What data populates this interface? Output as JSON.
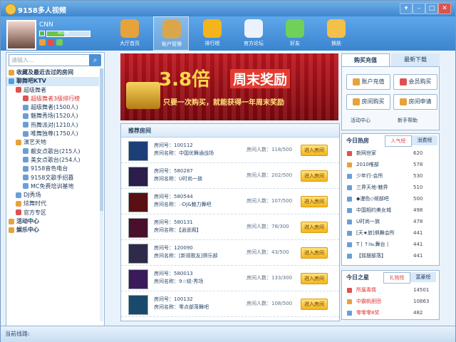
{
  "app": {
    "title": "9158多人视频"
  },
  "window_controls": {
    "menu": "▾",
    "minimize": "–",
    "maximize": "□",
    "close": "✕"
  },
  "user": {
    "name": "CNN",
    "level_pct": "40%"
  },
  "nav": [
    {
      "label": "大厅首页",
      "icon": "house-icon",
      "color": "#e6a23c"
    },
    {
      "label": "账户管理",
      "icon": "wallet-icon",
      "color": "#d9a74a",
      "active": true
    },
    {
      "label": "排行榜",
      "icon": "trophy-icon",
      "color": "#f3b51b"
    },
    {
      "label": "官方论坛",
      "icon": "chat-bubble-icon",
      "color": "#eaf2fb"
    },
    {
      "label": "好友",
      "icon": "users-icon",
      "color": "#6fd05a"
    },
    {
      "label": "换肤",
      "icon": "refresh-icon",
      "color": "#f5c04a"
    }
  ],
  "sidebar": {
    "search_placeholder": "请输入...",
    "tree": [
      {
        "label": "收藏及最近去过的房间",
        "level": 0,
        "color": "#e6a23c"
      },
      {
        "label": "聊舞吧KTV",
        "level": 0,
        "color": "#4aa3e0",
        "selected": true
      },
      {
        "label": "超级舞者",
        "level": 1,
        "color": "#e05050"
      },
      {
        "label": "超级舞者3级排行榜",
        "level": 2,
        "color": "#e05050",
        "red": true
      },
      {
        "label": "超级舞者(1500人)",
        "level": 2,
        "color": "#6b9ed6"
      },
      {
        "label": "魅舞秀场(1520人)",
        "level": 2,
        "color": "#6b9ed6"
      },
      {
        "label": "热舞派对(1210人)",
        "level": 2,
        "color": "#6b9ed6"
      },
      {
        "label": "唯舞独尊(1750人)",
        "level": 2,
        "color": "#6b9ed6"
      },
      {
        "label": "演艺天地",
        "level": 1,
        "color": "#e6a23c"
      },
      {
        "label": "靓女点歌台(215人)",
        "level": 2,
        "color": "#6b9ed6"
      },
      {
        "label": "美女点歌台(254人)",
        "level": 2,
        "color": "#6b9ed6"
      },
      {
        "label": "9158音色电台",
        "level": 2,
        "color": "#6b9ed6"
      },
      {
        "label": "9158文歌手招募",
        "level": 2,
        "color": "#6b9ed6"
      },
      {
        "label": "MC免费培训基地",
        "level": 2,
        "color": "#6b9ed6"
      },
      {
        "label": "DJ秀场",
        "level": 1,
        "color": "#6b9ed6"
      },
      {
        "label": "炫舞时代",
        "level": 1,
        "color": "#e6a23c"
      },
      {
        "label": "官方专区",
        "level": 1,
        "color": "#e05050"
      },
      {
        "label": "活动中心",
        "level": 0,
        "color": "#e6a23c"
      },
      {
        "label": "娱乐中心",
        "level": 0,
        "color": "#e6a23c"
      }
    ]
  },
  "banner": {
    "big": "3.8倍",
    "big2": "周末奖励",
    "sub": "只要一次购买，就能获得一年周末奖励"
  },
  "rooms": {
    "header": "推荐房间",
    "enter_label": "进入房间",
    "items": [
      {
        "id": "房间号：100112",
        "name": "房间名称：中国优舞通战场",
        "count": "房间人数：118/500",
        "color": "#1c3f78"
      },
      {
        "id": "房间号：580287",
        "name": "房间名称：U时尚一族",
        "count": "房间人数：202/500",
        "color": "#2b1e4a"
      },
      {
        "id": "房间号：580544",
        "name": "房间名称：.-DJ&魅力舞吧",
        "count": "房间人数：107/500",
        "color": "#5a0f12"
      },
      {
        "id": "房间号：580131",
        "name": "房间名称：【逍遥阁】",
        "count": "房间人数：78/300",
        "color": "#4a0f2b"
      },
      {
        "id": "房间号：120090",
        "name": "房间名称：[新视歌友]俱乐部",
        "count": "房间人数：43/500",
        "color": "#2f2a4a"
      },
      {
        "id": "房间号：580013",
        "name": "房间名称：9☆縂-秀场",
        "count": "房间人数：133/300",
        "color": "#3a1a5a"
      },
      {
        "id": "房间号：100132",
        "name": "房间名称：零点部落舞吧",
        "count": "房间人数：108/500",
        "color": "#1a4a6b"
      }
    ]
  },
  "right": {
    "tabs": [
      "购买充值",
      "最新下载"
    ],
    "buttons": [
      "账户充值",
      "会员购买",
      "房间购买",
      "房间申请"
    ],
    "links": [
      "活动中心",
      "新手帮助"
    ],
    "hot_title": "今日热房",
    "hot_tabs": [
      "人气榜",
      "消费榜"
    ],
    "hot": [
      {
        "name": "新网世家",
        "value": "620",
        "color": "#e05050"
      },
      {
        "name": "2010唯部",
        "value": "578",
        "color": "#e6a23c"
      },
      {
        "name": "少年行-会所",
        "value": "530",
        "color": "#6b9ed6"
      },
      {
        "name": "三界天地-魅界",
        "value": "510",
        "color": "#6b9ed6"
      },
      {
        "name": "◆漫色◇倾部吧",
        "value": "500",
        "color": "#6b9ed6"
      },
      {
        "name": "中国相约美女城",
        "value": "498",
        "color": "#6b9ed6"
      },
      {
        "name": "U时尚一族",
        "value": "478",
        "color": "#6b9ed6"
      },
      {
        "name": "[天★旅]俱舞会所",
        "value": "441",
        "color": "#6b9ed6"
      },
      {
        "name": "T丨↑ⅰ℡舞台丨",
        "value": "441",
        "color": "#6b9ed6"
      },
      {
        "name": "【摇摆部落】",
        "value": "441",
        "color": "#6b9ed6"
      }
    ],
    "star_title": "今日之星",
    "star_tabs": [
      "礼物榜",
      "富豪榜"
    ],
    "stars": [
      {
        "name": "所属毒情",
        "value": "14501",
        "color": "#e05050"
      },
      {
        "name": "中霸帆胆团",
        "value": "10863",
        "color": "#e6a23c"
      },
      {
        "name": "零零零8奖",
        "value": "482",
        "color": "#6b9ed6"
      }
    ]
  },
  "status": {
    "text": "当前线路:"
  }
}
